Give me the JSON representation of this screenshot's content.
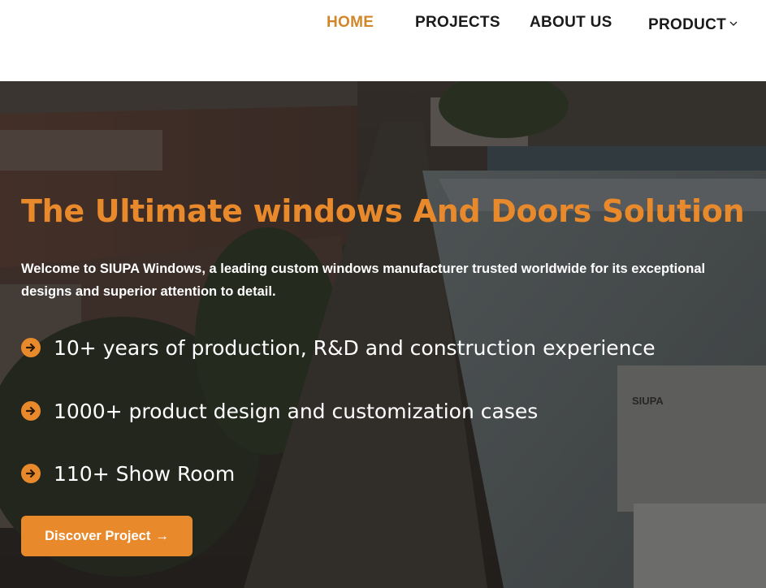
{
  "nav": {
    "items": [
      {
        "label": "HOME",
        "active": true
      },
      {
        "label": "PROJECTS",
        "active": false
      },
      {
        "label": "ABOUT US",
        "active": false
      },
      {
        "label": "PRODUCT",
        "active": false,
        "has_dropdown": true
      }
    ]
  },
  "hero": {
    "background_image": "aerial view of factory buildings with SIUPA sign",
    "sign_text": "SIUPA",
    "title": "The Ultimate windows And Doors Solution",
    "subtitle": "Welcome to SIUPA Windows, a leading custom  windows manufacturer trusted worldwide for its exceptional designs and superior attention to detail.",
    "features": [
      {
        "icon": "arrow-circle-icon",
        "text": "10+ years of production, R&D and construction experience"
      },
      {
        "icon": "arrow-circle-icon",
        "text": "1000+ product design and customization cases"
      },
      {
        "icon": "arrow-circle-icon",
        "text": "110+ Show Room"
      }
    ],
    "cta": {
      "label": "Discover Project",
      "arrow": "→"
    }
  },
  "colors": {
    "accent": "#e8892c",
    "nav_active": "#d2862a",
    "nav_text": "#1a1a1a",
    "hero_text": "#ffffff"
  }
}
